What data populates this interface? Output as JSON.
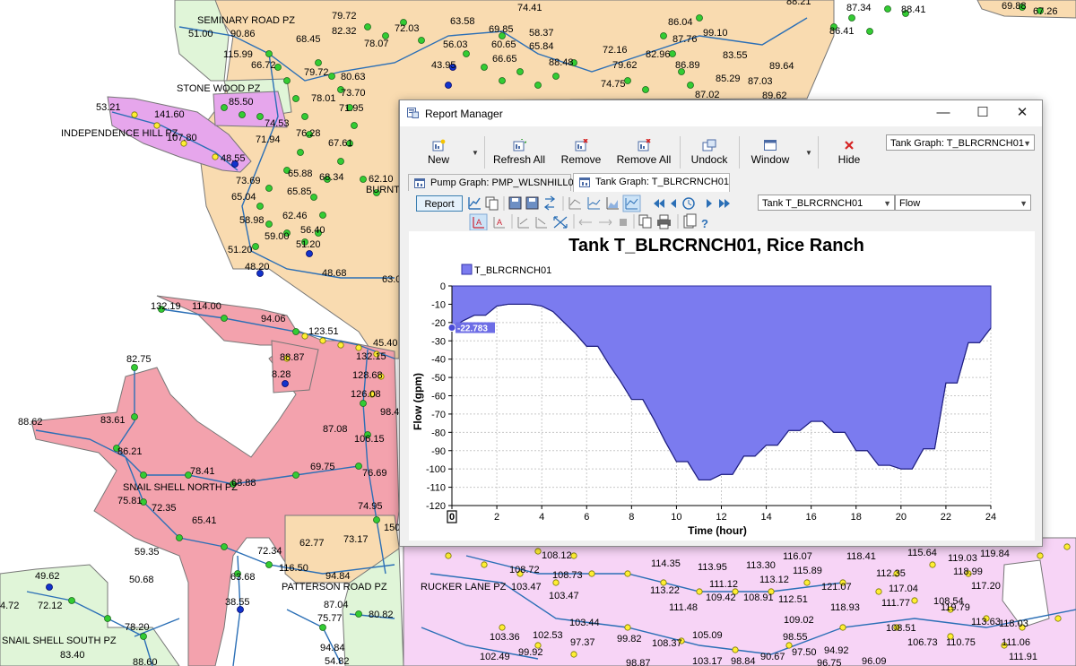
{
  "map": {
    "zones": [
      "SEMINARY ROAD PZ",
      "STONE WOOD PZ",
      "INDEPENDENCE HILL PZ",
      "SNAIL SHELL NORTH PZ",
      "PATTERSON ROAD PZ",
      "RUCKER LANE PZ",
      "SNAIL SHELL SOUTH PZ",
      "BURNT"
    ],
    "labels": [
      "88.21",
      "87.34",
      "86.41",
      "88.41",
      "69.88",
      "67.26",
      "79.72",
      "82.32",
      "78.07",
      "72.03",
      "56.03",
      "63.58",
      "58.37",
      "65.84",
      "60.65",
      "66.65",
      "69.85",
      "74.41",
      "86.04",
      "87.76",
      "99.10",
      "72.16",
      "79.62",
      "82.96",
      "86.89",
      "88.48",
      "43.95",
      "68.45",
      "66.72",
      "79.72",
      "80.63",
      "83.55",
      "85.29",
      "87.03",
      "89.64",
      "89.62",
      "87.02",
      "74.75",
      "51.00",
      "90.86",
      "115.99",
      "85.50",
      "74.53",
      "71.94",
      "78.01",
      "73.70",
      "71.95",
      "76.28",
      "67.61",
      "65.88",
      "65.85",
      "68.34",
      "53.21",
      "141.60",
      "107.80",
      "48.55",
      "73.69",
      "65.04",
      "58.98",
      "62.46",
      "56.40",
      "59.00",
      "51.20",
      "51.20",
      "48.20",
      "48.68",
      "62.10",
      "63.0",
      "132.19",
      "114.00",
      "94.06",
      "123.51",
      "45.40",
      "132.15",
      "88.87",
      "8.28",
      "82.75",
      "128.68",
      "126.08",
      "98.4",
      "88.62",
      "83.61",
      "86.21",
      "87.08",
      "106.15",
      "78.41",
      "69.75",
      "68.88",
      "76.69",
      "75.81",
      "72.35",
      "65.41",
      "74.95",
      "59.35",
      "50.68",
      "72.34",
      "63.68",
      "62.77",
      "73.17",
      "116.50",
      "150",
      "94.84",
      "87.04",
      "75.77",
      "80.82",
      "38.55",
      "49.62",
      "72.12",
      "4.72",
      "78.20",
      "83.40",
      "88.60",
      "94.84",
      "54.82",
      "108.12",
      "108.72",
      "108.73",
      "103.47",
      "103.47",
      "113.22",
      "114.35",
      "113.95",
      "113.30",
      "116.07",
      "115.89",
      "118.41",
      "115.64",
      "119.03",
      "119.84",
      "112.35",
      "118.99",
      "117.20",
      "118.93",
      "121.07",
      "112.51",
      "108.91",
      "109.42",
      "111.12",
      "111.48",
      "113.12",
      "117.04",
      "119.79",
      "111.77",
      "108.54",
      "103.44",
      "102.53",
      "97.37",
      "99.82",
      "103.36",
      "102.49",
      "99.92",
      "108.37",
      "105.09",
      "109.02",
      "98.55",
      "97.50",
      "94.92",
      "108.51",
      "106.73",
      "110.75",
      "113.63",
      "118.03",
      "111.06",
      "111.91",
      "103.17",
      "98.84",
      "98.87",
      "96.09",
      "96.75",
      "90.67"
    ]
  },
  "window": {
    "title": "Report Manager",
    "controls": {
      "minimize": "—",
      "maximize": "☐",
      "close": "✕"
    },
    "ribbon": {
      "new": "New",
      "refresh_all": "Refresh All",
      "remove": "Remove",
      "remove_all": "Remove All",
      "undock": "Undock",
      "window": "Window",
      "hide": "Hide",
      "graph_select": "Tank Graph: T_BLRCRNCH01"
    },
    "tabs": [
      "Pump Graph: PMP_WLSNHILL01",
      "Tank Graph: T_BLRCRNCH01"
    ],
    "toolbar": {
      "report": "Report",
      "element_select": "Tank T_BLRCRNCH01",
      "attribute_select": "Flow"
    }
  },
  "chart_data": {
    "type": "area",
    "title": "Tank T_BLRCRNCH01, Rice Ranch",
    "xlabel": "Time (hour)",
    "ylabel": "Flow (gpm)",
    "xlim": [
      0,
      24
    ],
    "ylim": [
      -120,
      0
    ],
    "xticks": [
      0,
      2,
      4,
      6,
      8,
      10,
      12,
      14,
      16,
      18,
      20,
      22,
      24
    ],
    "yticks": [
      0,
      -10,
      -20,
      -30,
      -40,
      -50,
      -60,
      -70,
      -80,
      -90,
      -100,
      -110,
      -120
    ],
    "grid": true,
    "legend_position": "top-left",
    "cursor_label": "-22.783",
    "series": [
      {
        "name": "T_BLRCRNCH01",
        "color": "#7b7bef",
        "x": [
          0,
          0.5,
          1,
          1.5,
          2,
          2.5,
          3,
          3.5,
          4,
          4.5,
          5,
          5.5,
          6,
          6.5,
          7,
          7.5,
          8,
          8.5,
          9,
          9.5,
          10,
          10.5,
          11,
          11.5,
          12,
          12.5,
          13,
          13.5,
          14,
          14.5,
          15,
          15.5,
          16,
          16.5,
          17,
          17.5,
          18,
          18.5,
          19,
          19.5,
          20,
          20.5,
          21,
          21.5,
          22,
          22.5,
          23,
          23.5,
          24
        ],
        "values": [
          -22.783,
          -19,
          -16,
          -16,
          -11,
          -10,
          -10,
          -10,
          -11,
          -14,
          -20,
          -26,
          -33,
          -33,
          -43,
          -52,
          -62,
          -62,
          -73,
          -85,
          -96,
          -96,
          -106,
          -106,
          -103,
          -103,
          -93,
          -93,
          -87,
          -87,
          -79,
          -79,
          -74,
          -74,
          -80,
          -80,
          -90,
          -90,
          -98,
          -98,
          -100,
          -100,
          -89,
          -89,
          -53,
          -53,
          -31,
          -31,
          -23
        ]
      }
    ]
  }
}
